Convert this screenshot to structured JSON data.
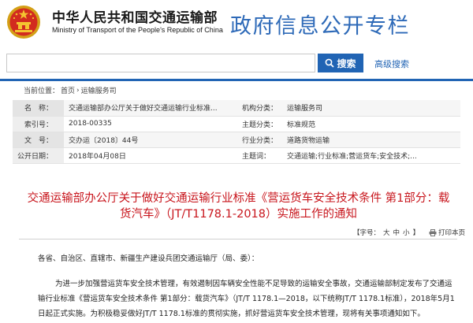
{
  "header": {
    "org_name_cn": "中华人民共和国交通运输部",
    "org_name_en": "Ministry of Transport of the People's Republic of China",
    "portal_title": "政府信息公开专栏",
    "emblem_icon": "national-emblem-icon"
  },
  "search": {
    "value": "",
    "placeholder": "",
    "button_label": "搜索",
    "advanced_label": "高级搜索"
  },
  "breadcrumb": {
    "prefix": "当前位置：",
    "home": "首页",
    "separator": "›",
    "current": "运输服务司"
  },
  "meta": {
    "rows": [
      {
        "label1": "名　称：",
        "value1": "交通运输部办公厅关于做好交通运输行业标准...",
        "label2": "机构分类：",
        "value2": "运输服务司"
      },
      {
        "label1": "索引号：",
        "value1": "2018-00335",
        "label2": "主题分类：",
        "value2": "标准规范"
      },
      {
        "label1": "文　号：",
        "value1": "交办运〔2018〕44号",
        "label2": "行业分类：",
        "value2": "道路货物运输"
      },
      {
        "label1": "公开日期：",
        "value1": "2018年04月08日",
        "label2": "主题词：",
        "value2": "交通运输;行业标准;营运货车;安全技术;..."
      }
    ]
  },
  "document": {
    "title": "交通运输部办公厅关于做好交通运输行业标准《营运货车安全技术条件 第1部分：载货汽车》（JT/T1178.1-2018）实施工作的通知",
    "font_size_label": "【字号：",
    "font_large": "大",
    "font_medium": "中",
    "font_small": "小",
    "font_size_close": "】",
    "print_label": "打印本页",
    "salutation": "各省、自治区、直辖市、新疆生产建设兵团交通运输厅（局、委）：",
    "paragraph": "为进一步加强营运货车安全技术管理，有效遏制因车辆安全性能不足导致的运输安全事故，交通运输部制定发布了交通运输行业标准《营运货车安全技术条件 第1部分：载货汽车》（JT/T 1178.1—2018，以下统称JT/T 1178.1标准），2018年5月1日起正式实施。为积极稳妥做好JT/T 1178.1标准的贯彻实施，抓好营运货车安全技术管理，现将有关事项通知如下。"
  },
  "colors": {
    "brand_blue": "#2164b4",
    "title_red": "#c8161d"
  }
}
